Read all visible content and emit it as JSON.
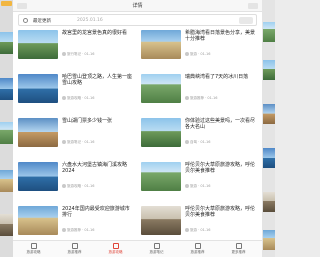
{
  "window": {
    "title": "详情"
  },
  "search": {
    "label": "最近更新",
    "date": "2025.01.16"
  },
  "cards": [
    {
      "title": "故宫里的龙宫景色真的很好看",
      "meta": "旅行笔记 · 01-16",
      "scene": "sky1"
    },
    {
      "title": "希腊海湾看日落景色分享，美景十分推荐",
      "meta": "旅游 · 01-16",
      "scene": "sky2"
    },
    {
      "title": "哈巴雪山登顶之路，人生第一座雪山攻略",
      "meta": "旅游攻略 · 01-16",
      "scene": "sky3"
    },
    {
      "title": "瑞典峡湾看了7天的冰川日落",
      "meta": "旅游推荐 · 01-16",
      "scene": "sky4"
    },
    {
      "title": "雪山湖门票多少钱一张",
      "meta": "旅游笔记 · 01-16",
      "scene": "sky6"
    },
    {
      "title": "你体验过这些美景吗，一次看尽各大名山",
      "meta": "自驾 · 01-16",
      "scene": "sky1"
    },
    {
      "title": "六盘水大河堡古镇海门溪攻略2024",
      "meta": "旅游攻略 · 01-16",
      "scene": "sky3"
    },
    {
      "title": "呼伦贝尔大草原旅游攻略，呼伦贝尔美食推荐",
      "meta": "旅游 · 01-16",
      "scene": "sky4"
    },
    {
      "title": "2024年国内最受欢迎旅游城市排行",
      "meta": "旅游推荐 · 01-16",
      "scene": "sky2"
    },
    {
      "title": "呼伦贝尔大草原旅游攻略，呼伦贝尔美食推荐",
      "meta": "旅游 · 01-16",
      "scene": "sky5"
    }
  ],
  "nav": [
    {
      "label": "旅游攻略"
    },
    {
      "label": "旅游推荐"
    },
    {
      "label": "旅游攻略"
    },
    {
      "label": "旅游笔记"
    },
    {
      "label": "旅游推荐"
    },
    {
      "label": "更多推荐"
    }
  ]
}
